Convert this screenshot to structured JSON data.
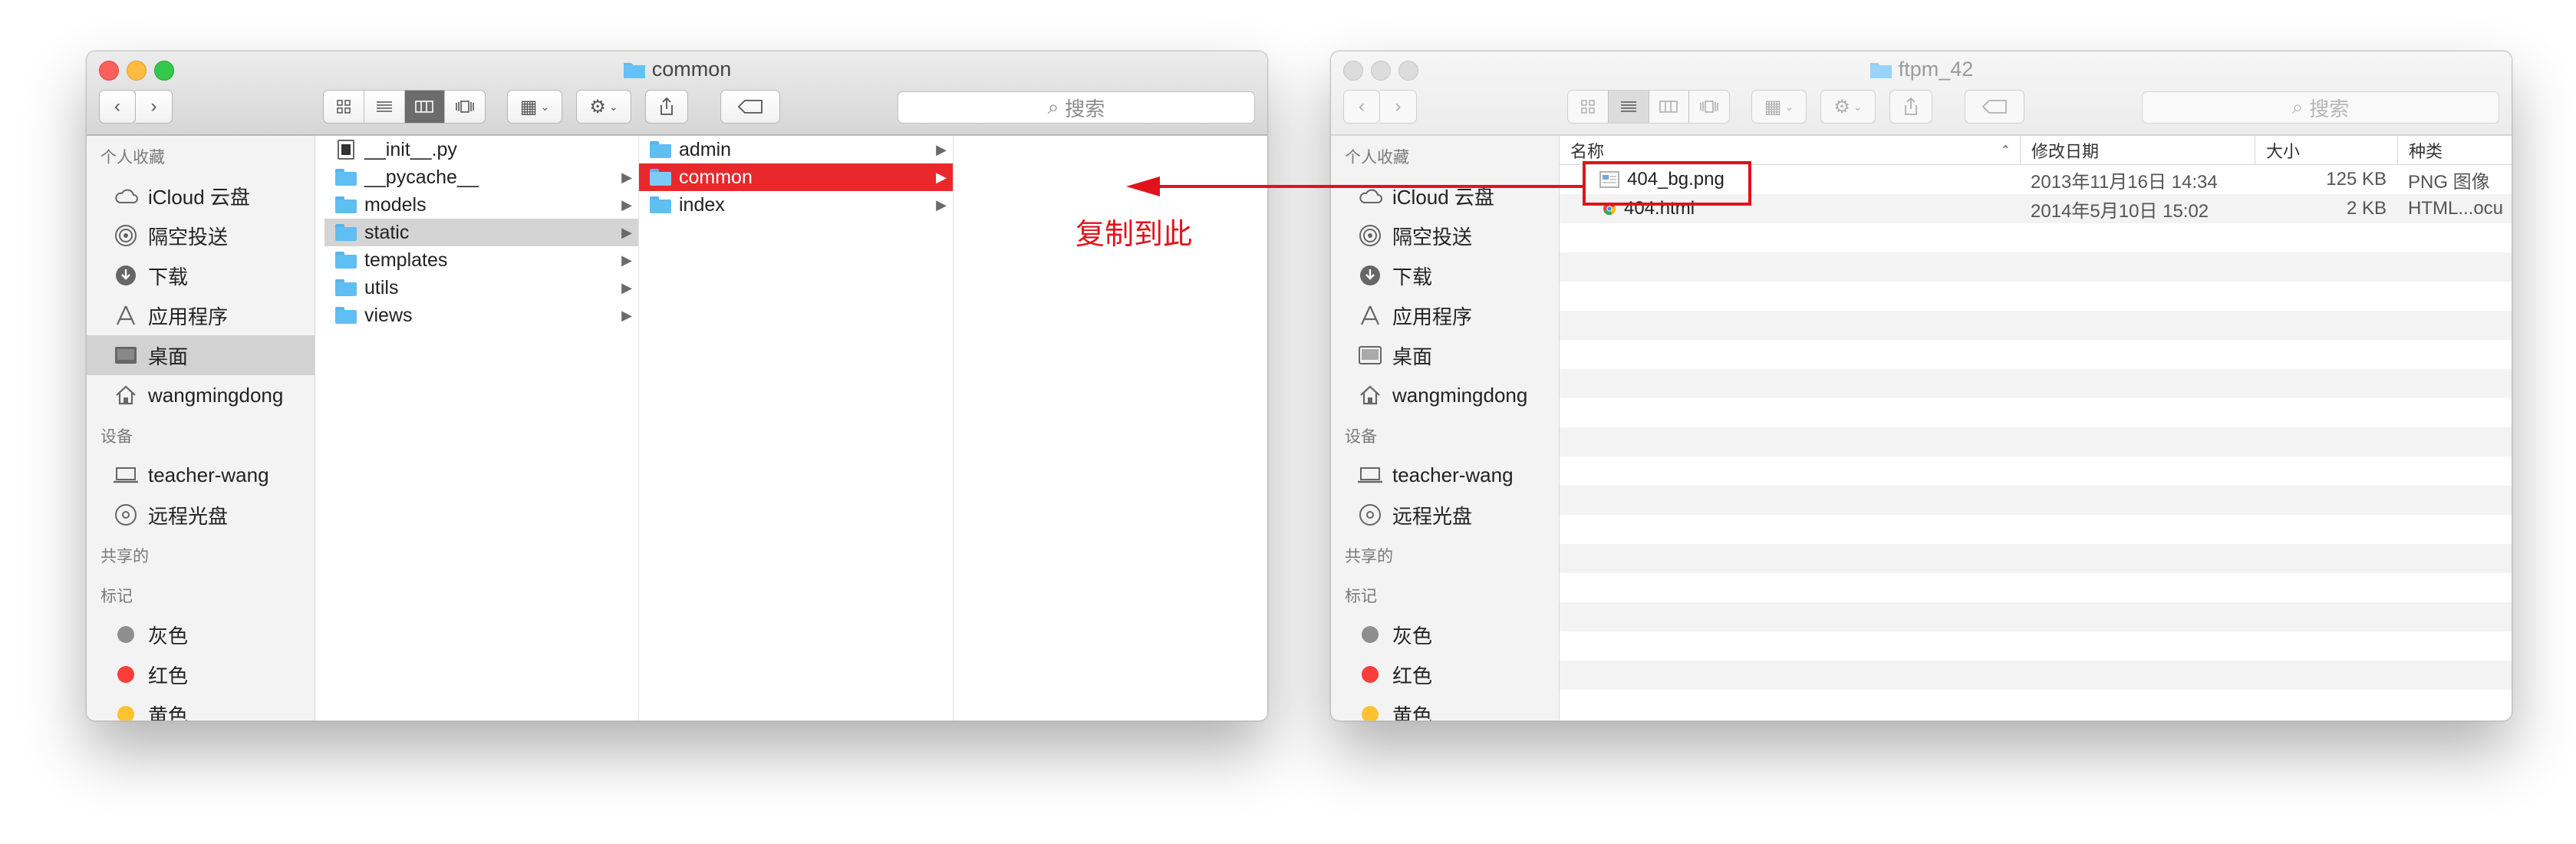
{
  "annotation": {
    "label": "复制到此",
    "color": "#e0131c"
  },
  "left_window": {
    "title": "common",
    "toolbar": {
      "search_placeholder": "搜索"
    },
    "sidebar": {
      "favorites_title": "个人收藏",
      "favorites": [
        {
          "label": "iCloud 云盘",
          "icon": "cloud-icon"
        },
        {
          "label": "隔空投送",
          "icon": "airdrop-icon"
        },
        {
          "label": "下载",
          "icon": "download-icon"
        },
        {
          "label": "应用程序",
          "icon": "applications-icon"
        },
        {
          "label": "桌面",
          "icon": "desktop-icon",
          "selected": true
        },
        {
          "label": "wangmingdong",
          "icon": "home-icon"
        }
      ],
      "devices_title": "设备",
      "devices": [
        {
          "label": "teacher-wang",
          "icon": "laptop-icon"
        },
        {
          "label": "远程光盘",
          "icon": "disc-icon"
        }
      ],
      "shared_title": "共享的",
      "tags_title": "标记",
      "tags": [
        {
          "label": "灰色",
          "color": "#8e8e8e"
        },
        {
          "label": "红色",
          "color": "#fc3d39"
        },
        {
          "label": "黄色",
          "color": "#fdc22f"
        }
      ]
    },
    "columns": {
      "col1": [
        {
          "label": "__init__.py",
          "type": "file"
        },
        {
          "label": "__pycache__",
          "type": "folder"
        },
        {
          "label": "models",
          "type": "folder"
        },
        {
          "label": "static",
          "type": "folder",
          "state": "highlighted"
        },
        {
          "label": "templates",
          "type": "folder"
        },
        {
          "label": "utils",
          "type": "folder"
        },
        {
          "label": "views",
          "type": "folder"
        }
      ],
      "col2": [
        {
          "label": "admin",
          "type": "folder"
        },
        {
          "label": "common",
          "type": "folder",
          "state": "selected"
        },
        {
          "label": "index",
          "type": "folder"
        }
      ]
    }
  },
  "right_window": {
    "title": "ftpm_42",
    "toolbar": {
      "search_placeholder": "搜索"
    },
    "sidebar": {
      "favorites_title": "个人收藏",
      "favorites": [
        {
          "label": "iCloud 云盘",
          "icon": "cloud-icon"
        },
        {
          "label": "隔空投送",
          "icon": "airdrop-icon"
        },
        {
          "label": "下载",
          "icon": "download-icon"
        },
        {
          "label": "应用程序",
          "icon": "applications-icon"
        },
        {
          "label": "桌面",
          "icon": "desktop-icon"
        },
        {
          "label": "wangmingdong",
          "icon": "home-icon"
        }
      ],
      "devices_title": "设备",
      "devices": [
        {
          "label": "teacher-wang",
          "icon": "laptop-icon"
        },
        {
          "label": "远程光盘",
          "icon": "disc-icon"
        }
      ],
      "shared_title": "共享的",
      "tags_title": "标记",
      "tags": [
        {
          "label": "灰色",
          "color": "#8e8e8e"
        },
        {
          "label": "红色",
          "color": "#fc3d39"
        },
        {
          "label": "黄色",
          "color": "#fdc22f"
        }
      ]
    },
    "list": {
      "headers": {
        "name": "名称",
        "modified": "修改日期",
        "size": "大小",
        "kind": "种类"
      },
      "rows": [
        {
          "name": "404_bg.png",
          "modified": "2013年11月16日 14:34",
          "size": "125 KB",
          "kind": "PNG 图像",
          "icon": "image-file-icon"
        },
        {
          "name": "404.html",
          "modified": "2014年5月10日 15:02",
          "size": "2 KB",
          "kind": "HTML...ocu",
          "icon": "chrome-html-icon"
        }
      ]
    }
  }
}
